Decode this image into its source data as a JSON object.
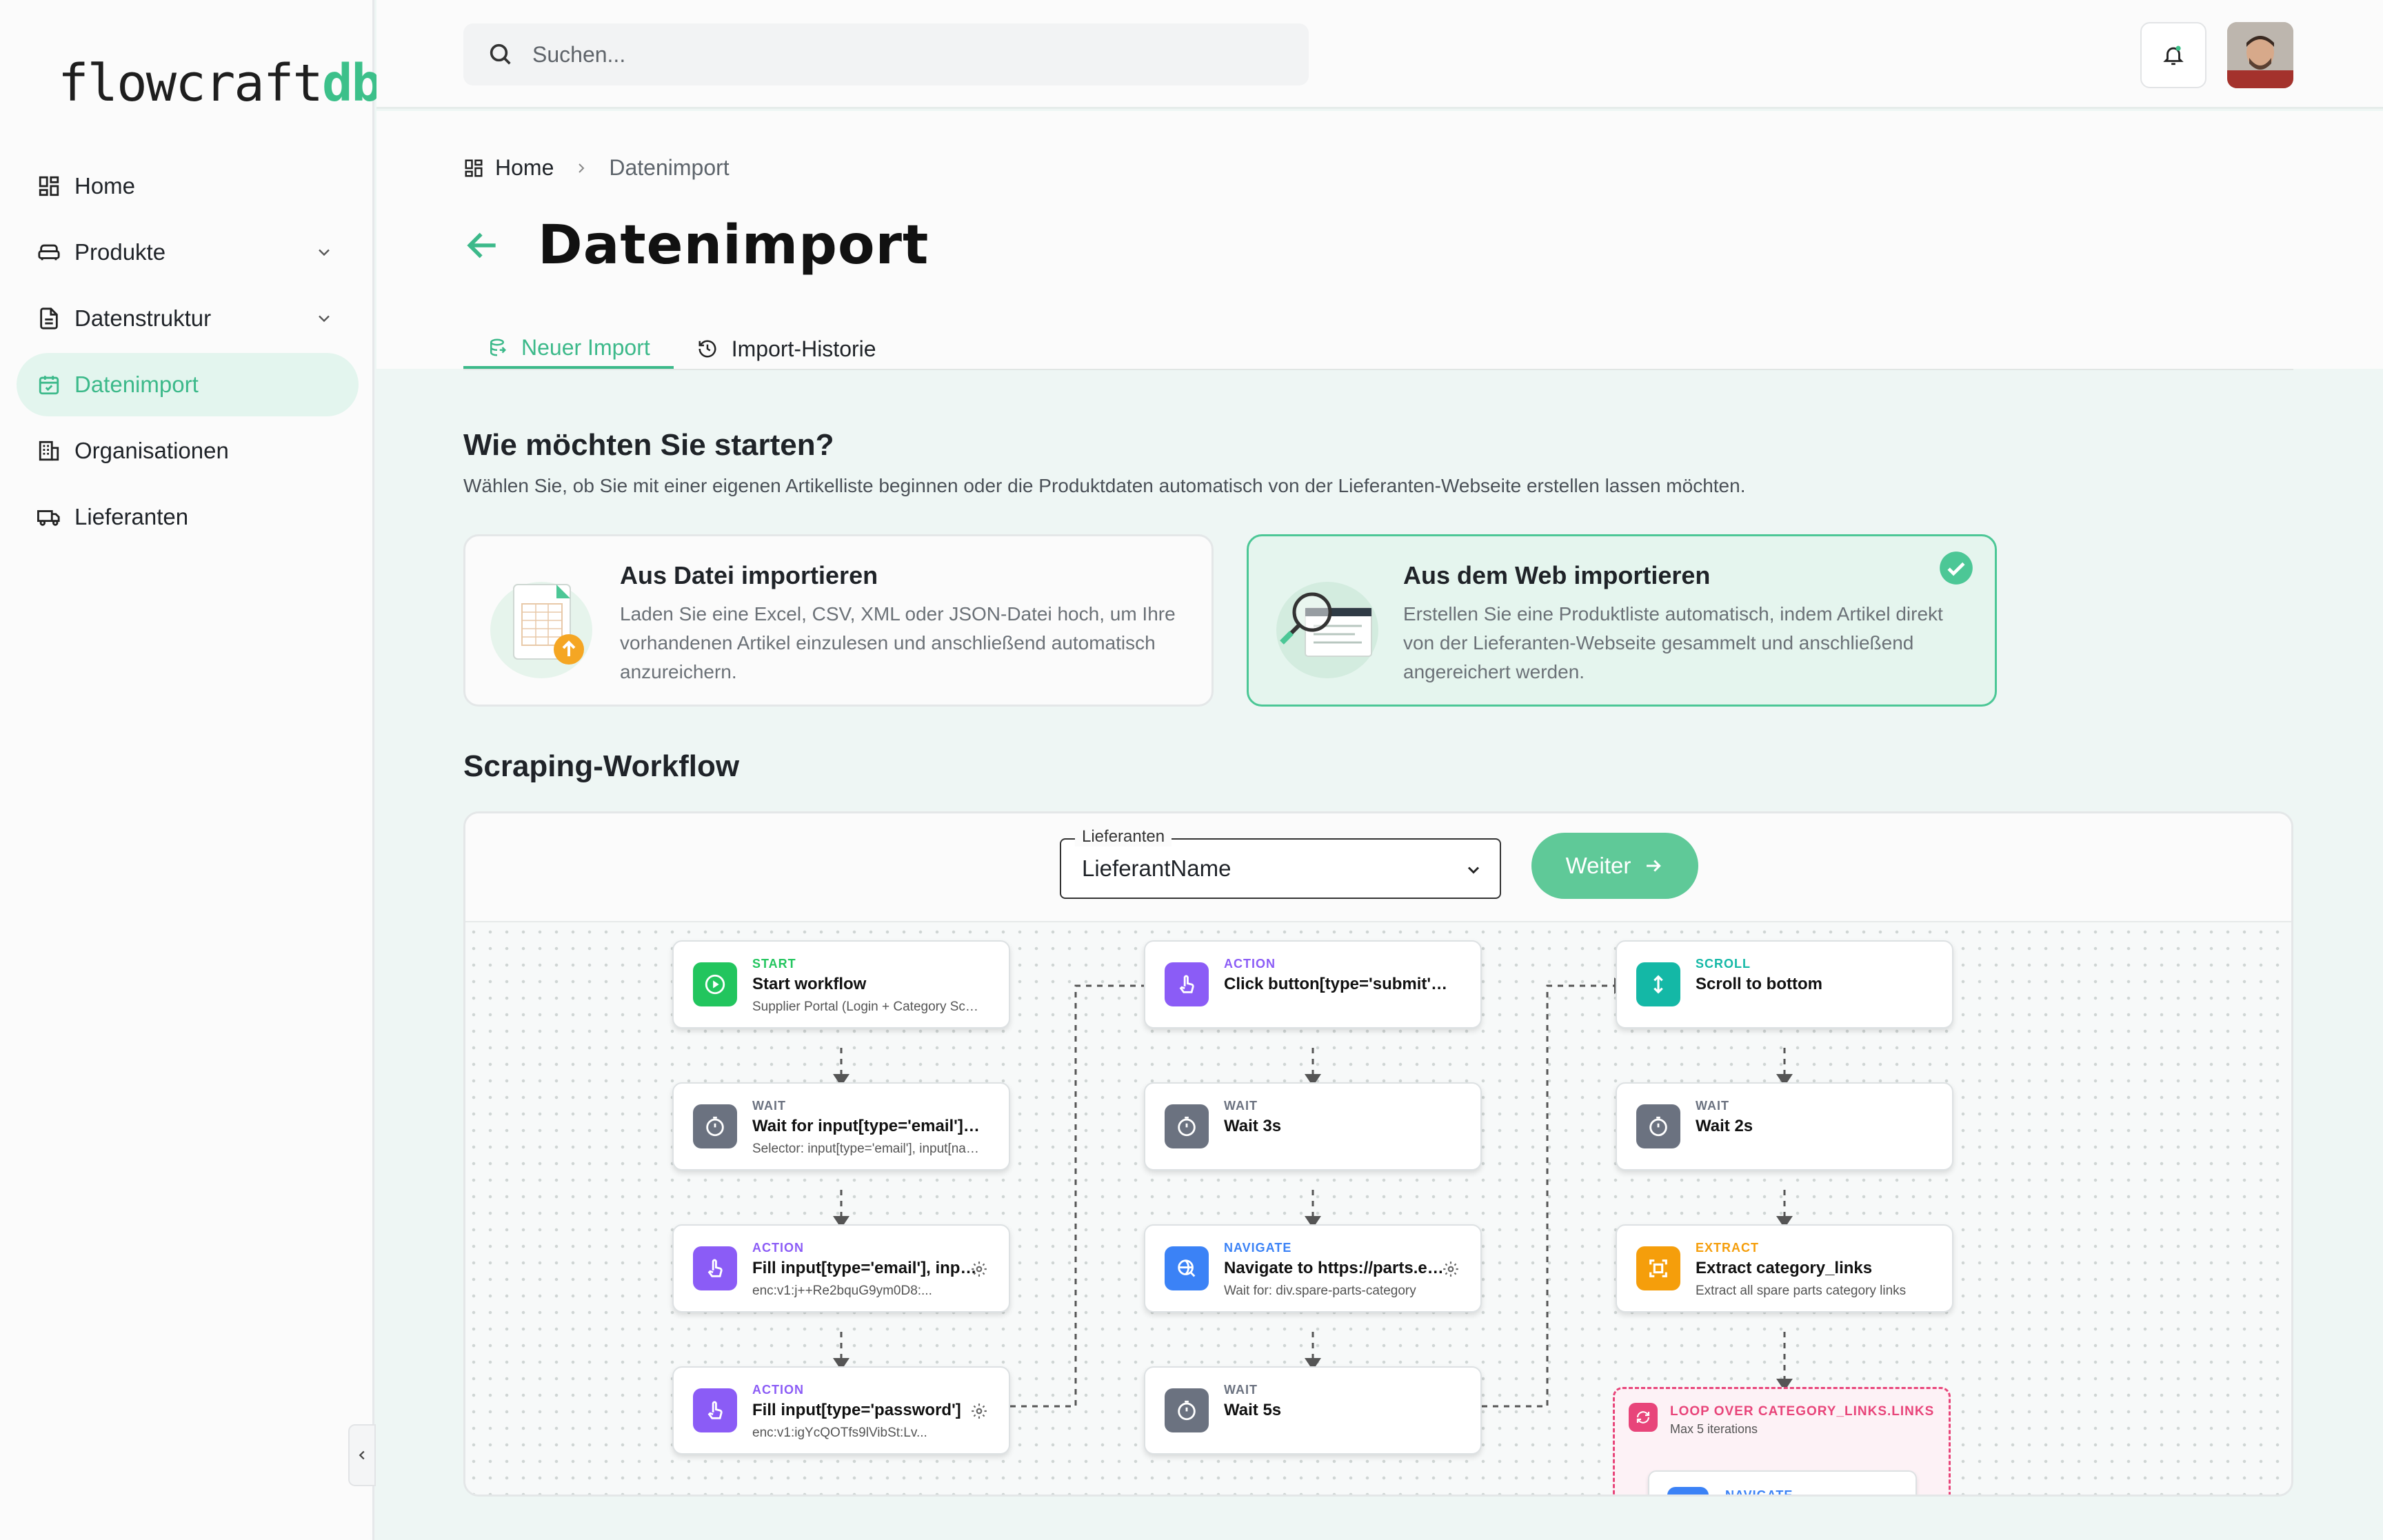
{
  "app": {
    "logo_main": "flowcraft",
    "logo_accent": "db"
  },
  "sidebar": {
    "items": [
      {
        "label": "Home",
        "icon": "grid-icon",
        "active": false,
        "expandable": false
      },
      {
        "label": "Produkte",
        "icon": "sofa-icon",
        "active": false,
        "expandable": true
      },
      {
        "label": "Datenstruktur",
        "icon": "document-icon",
        "active": false,
        "expandable": true
      },
      {
        "label": "Datenimport",
        "icon": "import-icon",
        "active": true,
        "expandable": false
      },
      {
        "label": "Organisationen",
        "icon": "building-icon",
        "active": false,
        "expandable": false
      },
      {
        "label": "Lieferanten",
        "icon": "truck-icon",
        "active": false,
        "expandable": false
      }
    ]
  },
  "topbar": {
    "search_placeholder": "Suchen..."
  },
  "breadcrumb": {
    "home": "Home",
    "current": "Datenimport"
  },
  "page": {
    "title": "Datenimport"
  },
  "tabs": [
    {
      "label": "Neuer Import",
      "active": true
    },
    {
      "label": "Import-Historie",
      "active": false
    }
  ],
  "start": {
    "heading": "Wie möchten Sie starten?",
    "subtitle": "Wählen Sie, ob Sie mit einer eigenen Artikelliste beginnen oder die Produktdaten automatisch von der Lieferanten-Webseite erstellen lassen möchten.",
    "options": [
      {
        "title": "Aus Datei importieren",
        "text": "Laden Sie eine Excel, CSV, XML oder JSON-Datei hoch, um Ihre vorhandenen Artikel einzulesen und anschließend automatisch anzureichern.",
        "selected": false
      },
      {
        "title": "Aus dem Web importieren",
        "text": "Erstellen Sie eine Produktliste automatisch, indem Artikel direkt von der Lieferanten-Webseite gesammelt und anschließend angereichert werden.",
        "selected": true
      }
    ]
  },
  "workflow": {
    "heading": "Scraping-Workflow",
    "select_label": "Lieferanten",
    "select_value": "LieferantName",
    "next_label": "Weiter",
    "nodes": [
      {
        "type": "START",
        "title": "Start workflow",
        "detail": "Supplier Portal (Login + Category Scrape)",
        "color": "#22c55e",
        "icon": "play-icon",
        "gear": false
      },
      {
        "type": "WAIT",
        "title": "Wait for input[type='email'], input[name='email']",
        "detail": "Selector: input[type='email'], input[name='email']",
        "color": "#6b7280",
        "icon": "timer-icon",
        "gear": false
      },
      {
        "type": "ACTION",
        "title": "Fill input[type='email'], input[name='email']",
        "detail": "enc:v1:j++Re2bquG9ym0D8:...",
        "color": "#8b5cf6",
        "icon": "pointer-icon",
        "gear": true
      },
      {
        "type": "ACTION",
        "title": "Fill input[type='password']",
        "detail": "enc:v1:igYcQOTfs9lVibSt:Lv...",
        "color": "#8b5cf6",
        "icon": "pointer-icon",
        "gear": true
      },
      {
        "type": "ACTION",
        "title": "Click button[type='submit'], button",
        "detail": "",
        "color": "#8b5cf6",
        "icon": "pointer-icon",
        "gear": false
      },
      {
        "type": "WAIT",
        "title": "Wait 3s",
        "detail": "",
        "color": "#6b7280",
        "icon": "timer-icon",
        "gear": false
      },
      {
        "type": "NAVIGATE",
        "title": "Navigate to https://parts.example",
        "detail": "Wait for: div.spare-parts-category",
        "color": "#3b82f6",
        "icon": "globe-search-icon",
        "gear": true
      },
      {
        "type": "WAIT",
        "title": "Wait 5s",
        "detail": "",
        "color": "#6b7280",
        "icon": "timer-icon",
        "gear": false
      },
      {
        "type": "SCROLL",
        "title": "Scroll to bottom",
        "detail": "",
        "color": "#14b8a6",
        "icon": "scroll-icon",
        "gear": false
      },
      {
        "type": "WAIT",
        "title": "Wait 2s",
        "detail": "",
        "color": "#6b7280",
        "icon": "timer-icon",
        "gear": false
      },
      {
        "type": "EXTRACT",
        "title": "Extract category_links",
        "detail": "Extract all spare parts category links",
        "color": "#f59e0b",
        "icon": "extract-icon",
        "gear": false
      }
    ],
    "loop": {
      "type": "LOOP OVER CATEGORY_LINKS.LINKS",
      "detail": "Max 5 iterations",
      "inner_type": "NAVIGATE"
    }
  },
  "colors": {
    "accent": "#3cb98a",
    "selected_bg": "#e5f5ee",
    "loop": "#e8457a"
  }
}
